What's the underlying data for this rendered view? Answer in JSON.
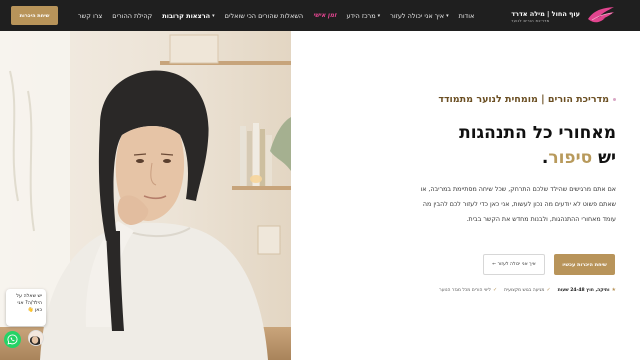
{
  "nav": {
    "cta_label": "שיחת היכרות",
    "items": [
      {
        "label": "צרו קשר",
        "bold": false,
        "dropdown": false
      },
      {
        "label": "קהילת ההורים",
        "bold": false,
        "dropdown": false
      },
      {
        "label": "הרצאות קרובות",
        "bold": true,
        "dropdown": true
      },
      {
        "label": "השאלות שהורים הכי שואלים",
        "bold": false,
        "dropdown": false
      },
      {
        "label": "זמן אישי",
        "bold": false,
        "dropdown": false,
        "style": "pink"
      },
      {
        "label": "מרכז הידע",
        "bold": false,
        "dropdown": true
      },
      {
        "label": "איך אני יכולה לעזור",
        "bold": false,
        "dropdown": true
      },
      {
        "label": "אודות",
        "bold": false,
        "dropdown": false
      }
    ],
    "logo_title": "עוף החול | מילה אדרד",
    "logo_subtitle": "מדריכת הורים לנוער"
  },
  "hero": {
    "eyebrow": "מדריכת הורים | מומחית לנוער מתמודד",
    "headline_line1": "מאחורי כל התנהגות",
    "headline_line2_plain": "יש",
    "headline_line2_accent": "סיפור",
    "headline_line2_end": ".",
    "body": "אם אתם מרגישים שהילד שלכם התרחק, שכל שיחה מסתיימת במריבה, או שאתם פשוט לא יודעים מה נכון לעשות, אני כאן כדי לעזור לכם להבין מה עומד מאחורי ההתנהגות, ולבנות מחדש את הקשר בבית.",
    "primary_button": "שיחת היכרות עכשיו",
    "secondary_button": "איך אני יכולה לעזור ←",
    "features": [
      {
        "icon": "star",
        "text": "ותיקה, חוץ 24-48 שעות",
        "bold": true
      },
      {
        "icon": "check",
        "text": "מגיעה בגוש מקצועית",
        "bold": false
      },
      {
        "icon": "check",
        "text": "ליווי הורים מכל מגזר הנוער",
        "bold": false
      }
    ]
  },
  "chat": {
    "bubble_text": "יש שאלה על הילד/ה? אני כאן 👋"
  },
  "colors": {
    "nav_bg": "#1f1f1f",
    "gold": "#b8945a",
    "pink": "#e2458f",
    "whatsapp": "#25d366"
  }
}
